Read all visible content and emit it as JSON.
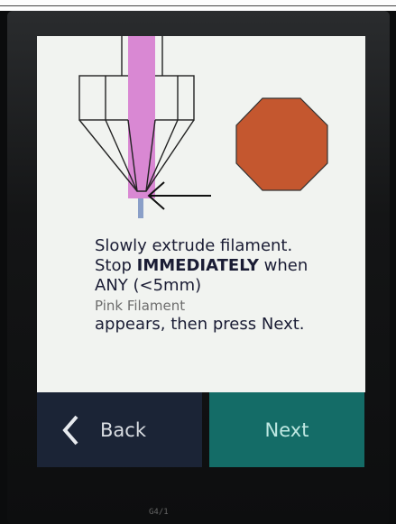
{
  "instructions": {
    "line1": "Slowly extrude filament.",
    "line2_prefix": "Stop ",
    "line2_strong": "IMMEDIATELY",
    "line2_suffix": " when",
    "line3": "ANY (<5mm)",
    "line4": "Pink Filament",
    "line5": "appears, then press Next."
  },
  "buttons": {
    "back_label": "Back",
    "next_label": "Next"
  },
  "board_text": "G4/1",
  "colors": {
    "filament": "#d988d3",
    "stop_sign": "#c4572f",
    "back_bg": "#1b2436",
    "next_bg": "#146c67"
  }
}
